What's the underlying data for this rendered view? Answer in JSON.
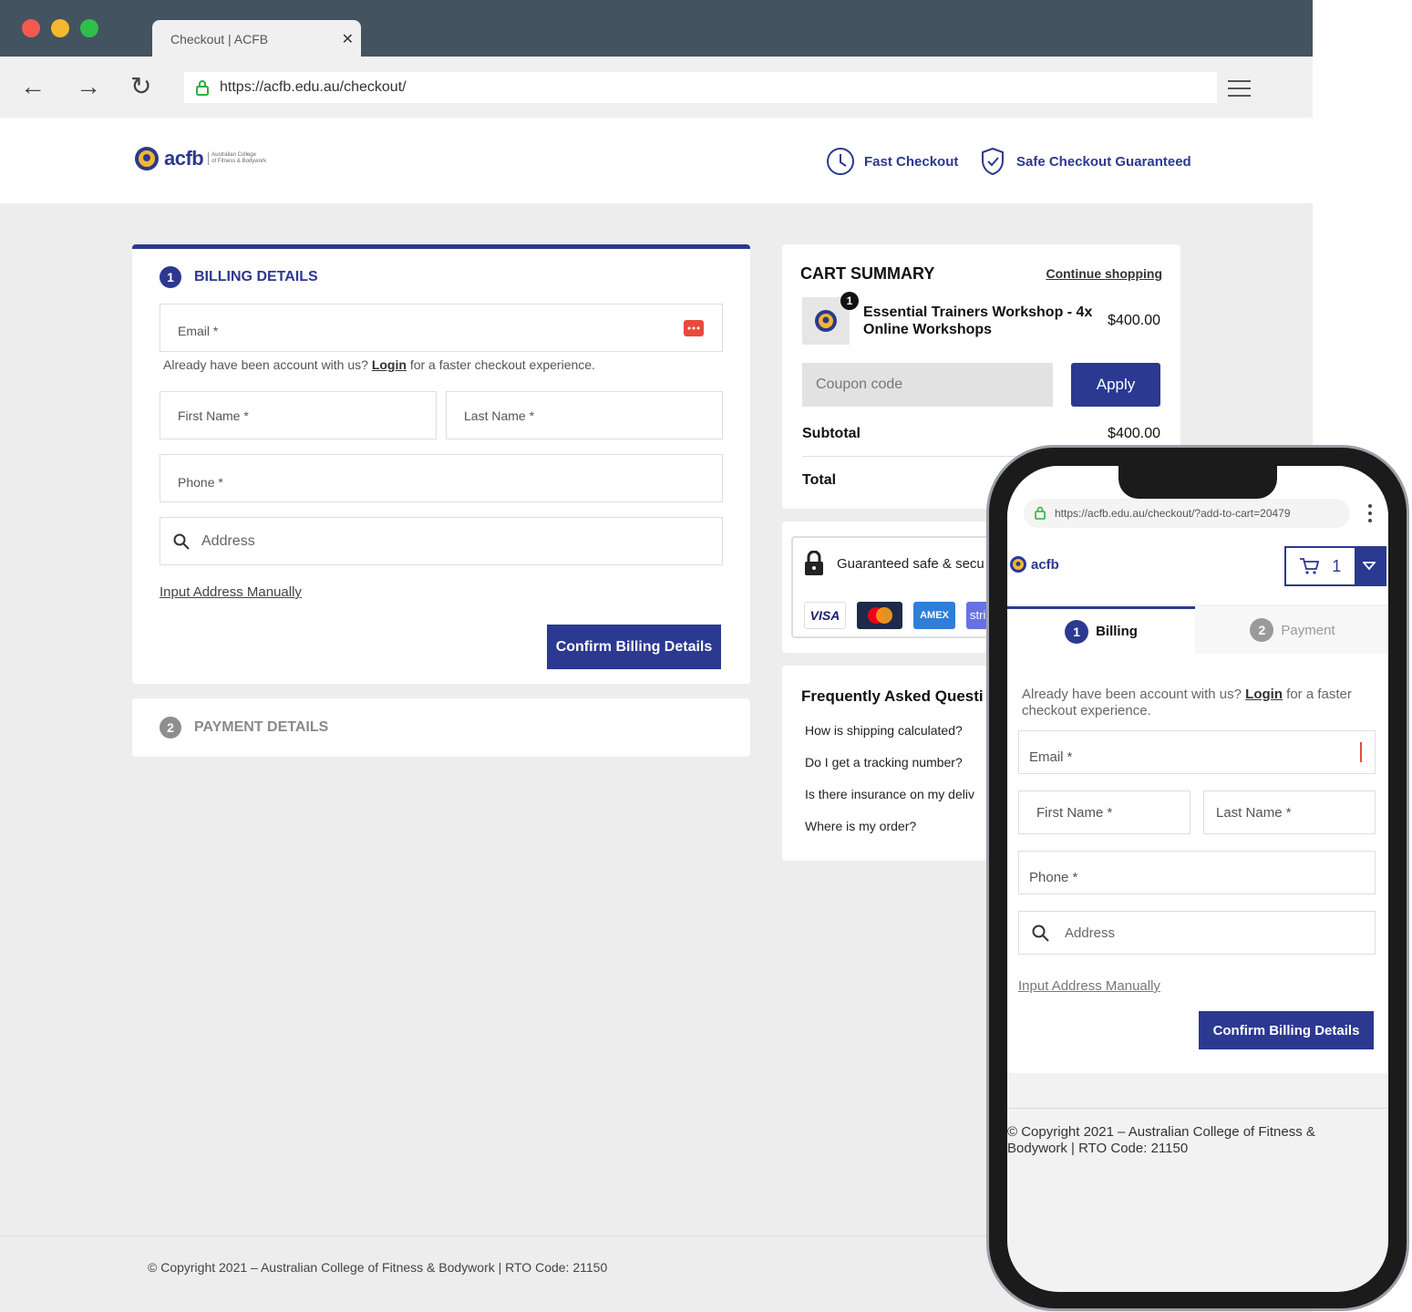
{
  "browser": {
    "tab_title": "Checkout | ACFB",
    "tab_close": "✕",
    "url": "https://acfb.edu.au/checkout/",
    "nav": {
      "back": "←",
      "forward": "→",
      "reload": "↻"
    }
  },
  "header": {
    "logo_text": "acfb",
    "logo_sub_1": "Australian College",
    "logo_sub_2": "of Fitness & Bodywork",
    "fast_checkout": "Fast Checkout",
    "safe_checkout": "Safe Checkout Guaranteed"
  },
  "billing": {
    "step": "1",
    "title": "BILLING DETAILS",
    "email_label": "Email *",
    "account_prefix": "Already have been account with us?",
    "login": "Login",
    "account_suffix": "for a faster checkout experience.",
    "first_name_label": "First Name *",
    "last_name_label": "Last Name *",
    "phone_label": "Phone *",
    "address_placeholder": "Address",
    "manual_address": "Input Address Manually",
    "confirm": "Confirm Billing Details"
  },
  "payment": {
    "step": "2",
    "title": "PAYMENT DETAILS"
  },
  "cart": {
    "title": "CART SUMMARY",
    "continue": "Continue shopping",
    "item_qty": "1",
    "item_name_1": "Essential Trainers Workshop - 4x",
    "item_name_2": "Online Workshops",
    "item_price": "$400.00",
    "coupon_placeholder": "Coupon code",
    "apply": "Apply",
    "subtotal_label": "Subtotal",
    "subtotal_value": "$400.00",
    "total_label": "Total"
  },
  "secure": {
    "text": "Guaranteed safe & secu",
    "cards": [
      "VISA",
      "AMEX",
      "stri"
    ]
  },
  "faq": {
    "title": "Frequently Asked Questi",
    "items": [
      "How is shipping calculated?",
      "Do I get a tracking number?",
      "Is there insurance on my deliv",
      "Where is my order?"
    ]
  },
  "footer": {
    "copyright": "© Copyright 2021 – Australian College of Fitness & Bodywork | RTO Code: 21150"
  },
  "mobile": {
    "url": "https://acfb.edu.au/checkout/?add-to-cart=20479",
    "logo_text": "acfb",
    "cart_count": "1",
    "tab_billing_num": "1",
    "tab_billing": "Billing",
    "tab_payment_num": "2",
    "tab_payment": "Payment",
    "account_prefix": "Already have been account with us?",
    "login": "Login",
    "account_suffix_1": "for a faster",
    "account_suffix_2": "checkout experience.",
    "email_label": "Email *",
    "first_name_label": "First Name *",
    "last_name_label": "Last Name *",
    "phone_label": "Phone *",
    "address_placeholder": "Address",
    "manual_address": "Input Address Manually",
    "confirm": "Confirm Billing Details",
    "copyright_1": "© Copyright 2021 – Australian College of Fitness &",
    "copyright_2": "Bodywork | RTO Code: 21150"
  },
  "colors": {
    "brand": "#2b3990",
    "titlebar": "#435360",
    "background": "#ededed"
  }
}
